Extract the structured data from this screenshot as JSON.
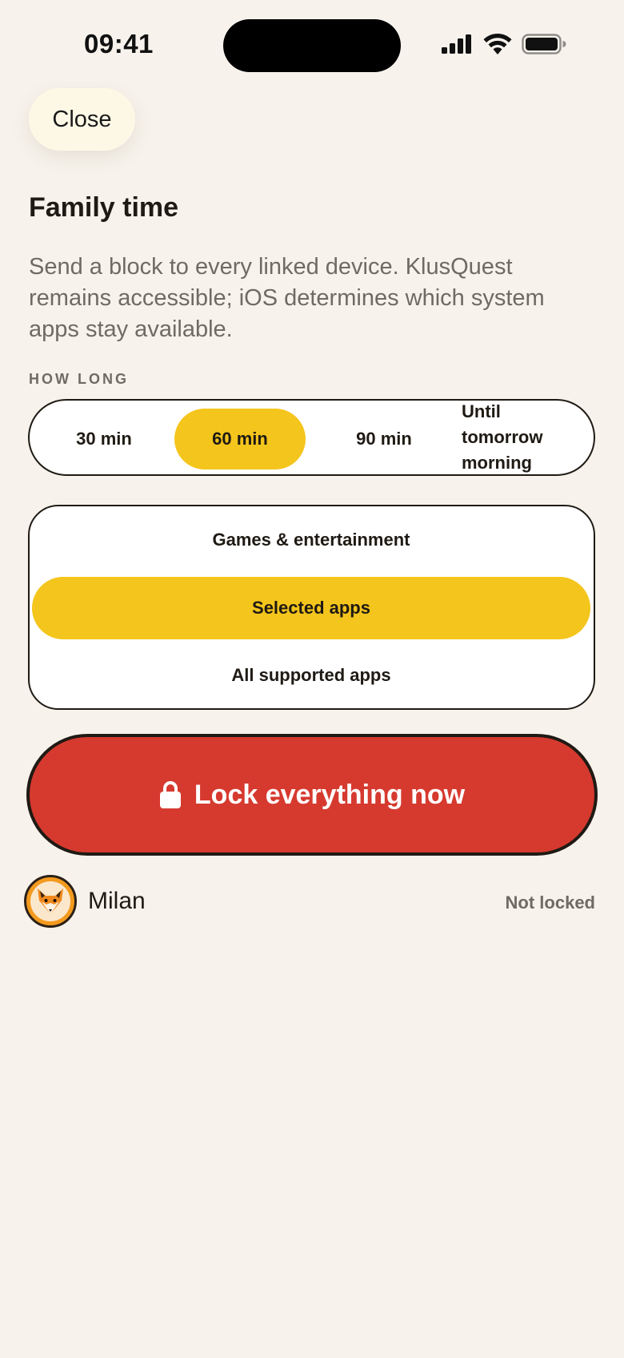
{
  "status_bar": {
    "time": "09:41"
  },
  "close_label": "Close",
  "title": "Family time",
  "description": "Send a block to every linked device. KlusQuest remains accessible; iOS determines which system apps stay available.",
  "duration": {
    "label": "HOW LONG",
    "options": [
      "30 min",
      "60 min",
      "90 min",
      "Until\ntomorrow\nmorning"
    ],
    "selected": "60 min"
  },
  "scope": {
    "options": [
      "Games & entertainment",
      "Selected apps",
      "All supported apps"
    ],
    "selected": "Selected apps"
  },
  "lock_button": {
    "label": "Lock everything now",
    "icon": "lock-icon"
  },
  "child": {
    "name": "Milan",
    "status": "Not locked",
    "avatar_icon": "fox-icon"
  },
  "colors": {
    "background": "#f7f3ec",
    "accent_yellow": "#f4c51c",
    "danger_red": "#d63a2f",
    "text_dark": "#1f1a14",
    "text_muted": "#6f6a63"
  }
}
